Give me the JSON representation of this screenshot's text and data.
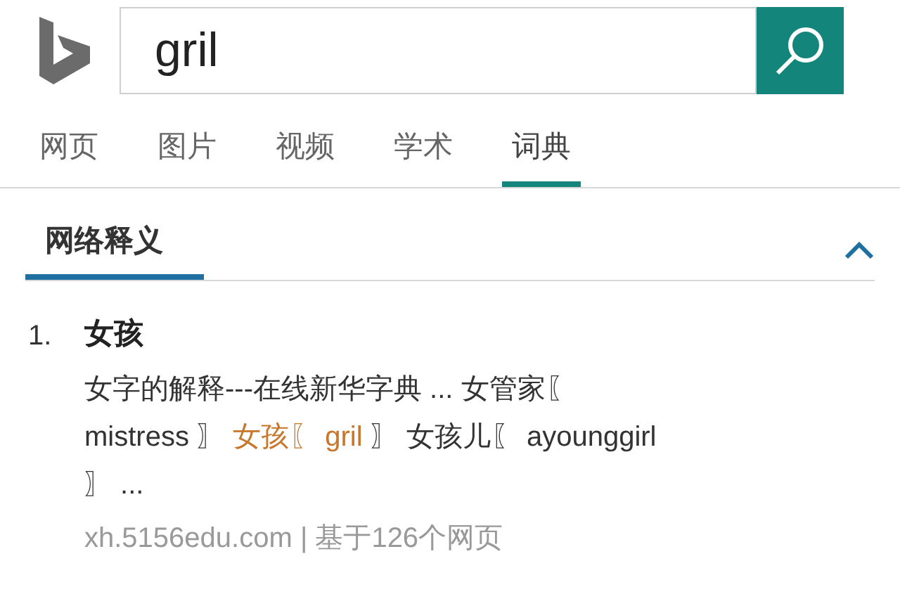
{
  "search": {
    "value": "gril"
  },
  "tabs": [
    {
      "label": "网页",
      "selected": false
    },
    {
      "label": "图片",
      "selected": false
    },
    {
      "label": "视频",
      "selected": false
    },
    {
      "label": "学术",
      "selected": false
    },
    {
      "label": "词典",
      "selected": true
    }
  ],
  "section": {
    "title": "网络释义",
    "expanded": true
  },
  "entries": [
    {
      "number": "1.",
      "title": "女孩",
      "description": [
        {
          "text": "女字的解释---在线新华字典 ... 女管家〖 mistress 〗 ",
          "highlight": false
        },
        {
          "text": "女孩〖 gril",
          "highlight": true
        },
        {
          "text": " 〗 女孩儿〖 ayounggirl 〗 ...",
          "highlight": false
        }
      ],
      "source": "xh.5156edu.com | 基于126个网页"
    }
  ]
}
